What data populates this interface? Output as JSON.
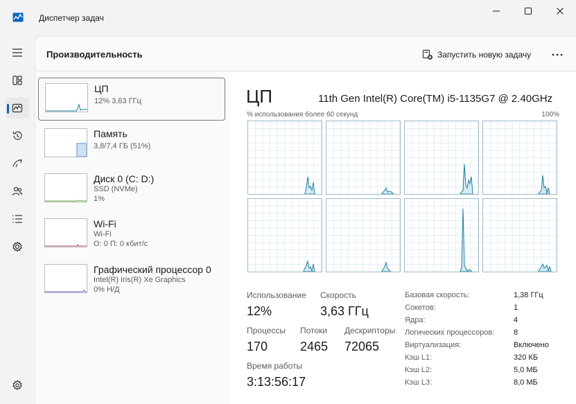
{
  "window": {
    "title": "Диспетчер задач",
    "controls": [
      "minimize-icon",
      "maximize-icon",
      "close-icon"
    ]
  },
  "rail": {
    "items": [
      {
        "icon": "hamburger-icon",
        "active": false
      },
      {
        "icon": "processes-icon",
        "active": false
      },
      {
        "icon": "performance-icon",
        "active": true
      },
      {
        "icon": "history-icon",
        "active": false
      },
      {
        "icon": "startup-icon",
        "active": false
      },
      {
        "icon": "users-icon",
        "active": false
      },
      {
        "icon": "details-icon",
        "active": false
      },
      {
        "icon": "services-icon",
        "active": false
      },
      {
        "icon": "settings-icon",
        "active": false
      }
    ]
  },
  "header": {
    "title": "Производительность",
    "run_task_label": "Запустить новую задачу",
    "more_label": "···"
  },
  "devices": [
    {
      "name": "ЦП",
      "sub1": "12% 3,63 ГГц",
      "sub2": "",
      "sub3": "",
      "selected": true
    },
    {
      "name": "Память",
      "sub1": "3,8/7,4 ГБ (51%)",
      "sub2": "",
      "sub3": "",
      "selected": false
    },
    {
      "name": "Диск 0 (C: D:)",
      "sub1": "SSD (NVMe)",
      "sub2": "1%",
      "sub3": "",
      "selected": false
    },
    {
      "name": "Wi-Fi",
      "sub1": "Wi-Fi",
      "sub2": "О: 0 П: 0 кбит/с",
      "sub3": "",
      "selected": false
    },
    {
      "name": "Графический процессор 0",
      "sub1": "Intel(R) Iris(R) Xe Graphics",
      "sub2": "0% Н/Д",
      "sub3": "",
      "selected": false
    }
  ],
  "cpu": {
    "title": "ЦП",
    "model": "11th Gen Intel(R) Core(TM) i5-1135G7 @ 2.40GHz",
    "util_label": "% использования более 60 секунд",
    "util_max": "100%",
    "graph_color": "#1c7ea0",
    "stats": {
      "usage_label": "Использование",
      "usage_value": "12%",
      "speed_label": "Скорость",
      "speed_value": "3,63 ГГц",
      "processes_label": "Процессы",
      "processes_value": "170",
      "threads_label": "Потоки",
      "threads_value": "2465",
      "handles_label": "Дескрипторы",
      "handles_value": "72065",
      "uptime_label": "Время работы",
      "uptime_value": "3:13:56:17"
    },
    "specs": [
      {
        "k": "Базовая скорость:",
        "v": "1,38 ГГц"
      },
      {
        "k": "Сокетов:",
        "v": "1"
      },
      {
        "k": "Ядра:",
        "v": "4"
      },
      {
        "k": "Логических процессоров:",
        "v": "8"
      },
      {
        "k": "Виртуализация:",
        "v": "Включено"
      },
      {
        "k": "Кэш L1:",
        "v": "320 КБ"
      },
      {
        "k": "Кэш L2:",
        "v": "5,0 МБ"
      },
      {
        "k": "Кэш L3:",
        "v": "8,0 МБ"
      }
    ]
  }
}
